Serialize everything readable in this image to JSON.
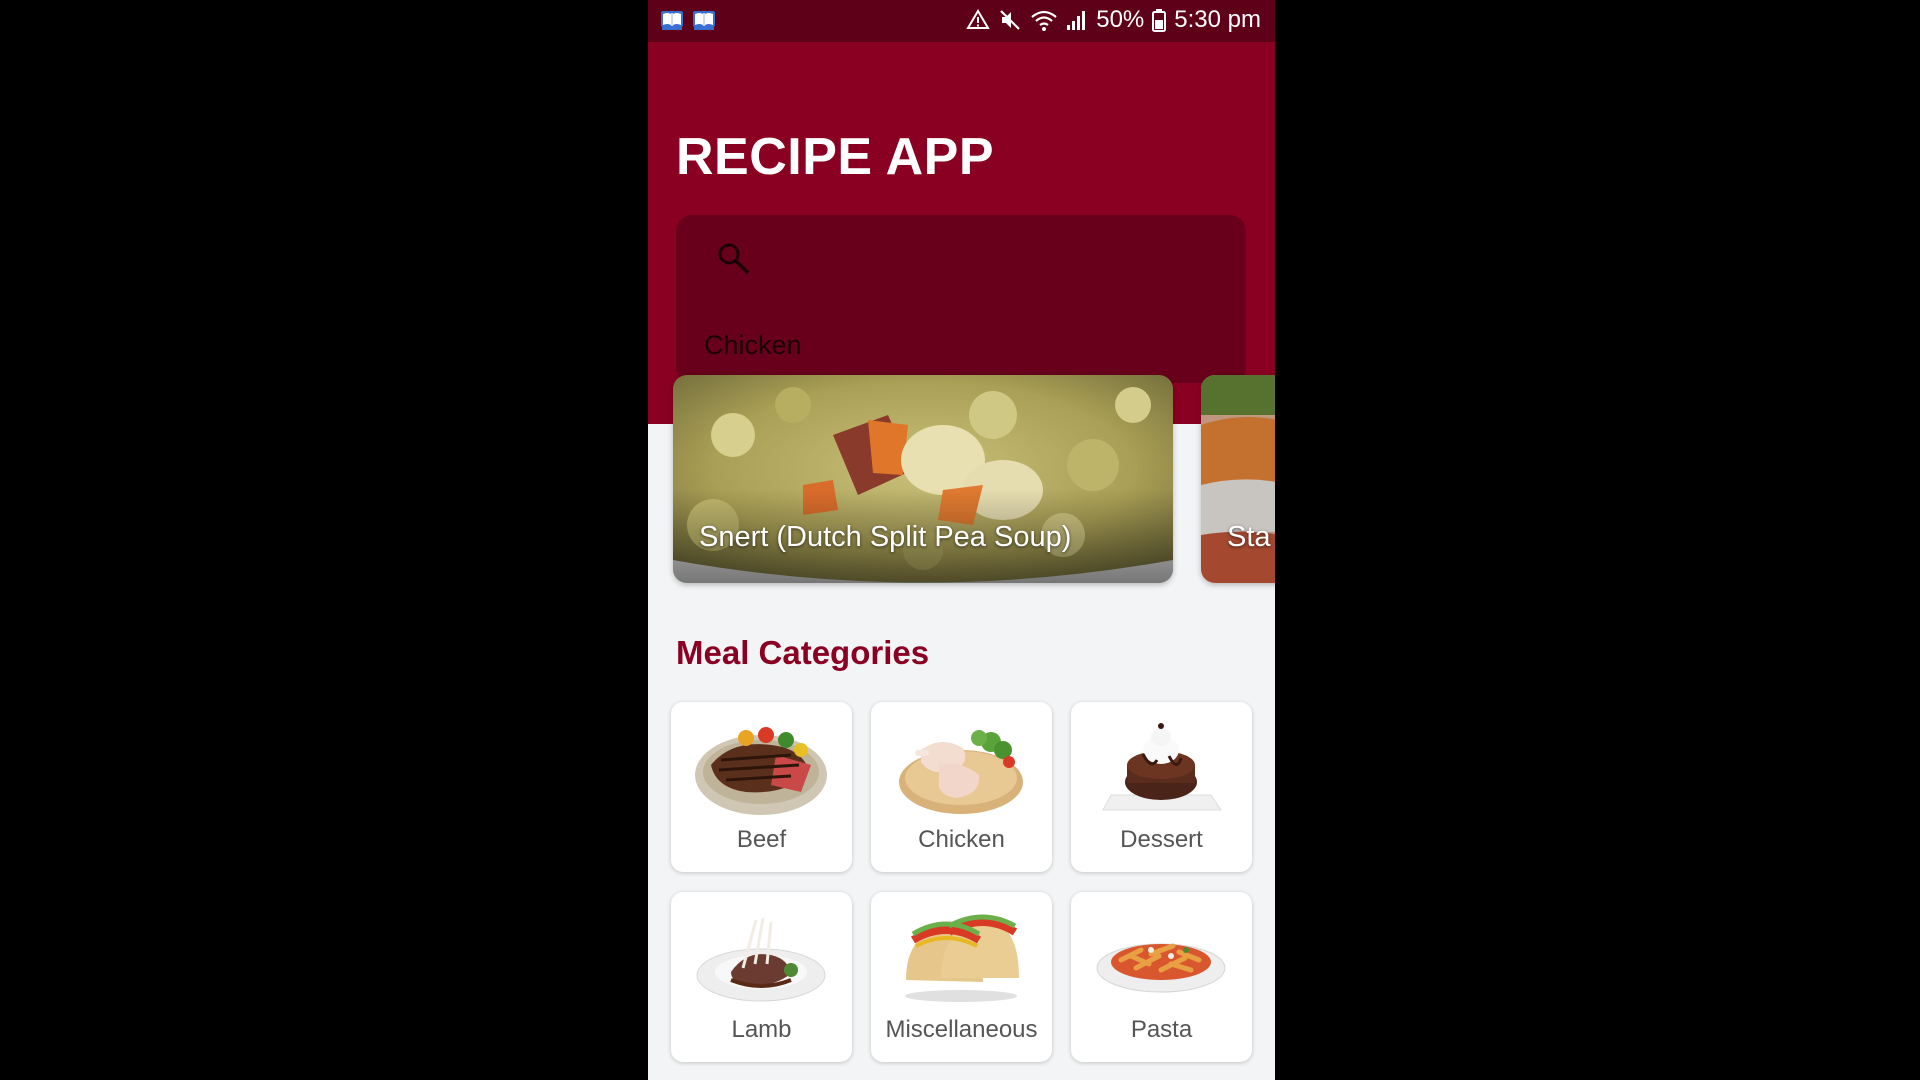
{
  "status_bar": {
    "notifications": [
      "book-icon",
      "book-icon"
    ],
    "battery": "50%",
    "time": "5:30 pm"
  },
  "app": {
    "title": "RECIPE APP",
    "search": {
      "value": "Chicken"
    }
  },
  "featured_meals": [
    {
      "label": "Snert (Dutch Split Pea Soup)"
    },
    {
      "label": "Sta"
    }
  ],
  "categories_section": {
    "title": "Meal Categories",
    "items": [
      {
        "label": "Beef"
      },
      {
        "label": "Chicken"
      },
      {
        "label": "Dessert"
      },
      {
        "label": "Lamb"
      },
      {
        "label": "Miscellaneous"
      },
      {
        "label": "Pasta"
      }
    ]
  },
  "colors": {
    "primary": "#8a0022",
    "status_bar": "#5e0018",
    "search_bg": "#68001b",
    "background": "#f2f4f5"
  }
}
